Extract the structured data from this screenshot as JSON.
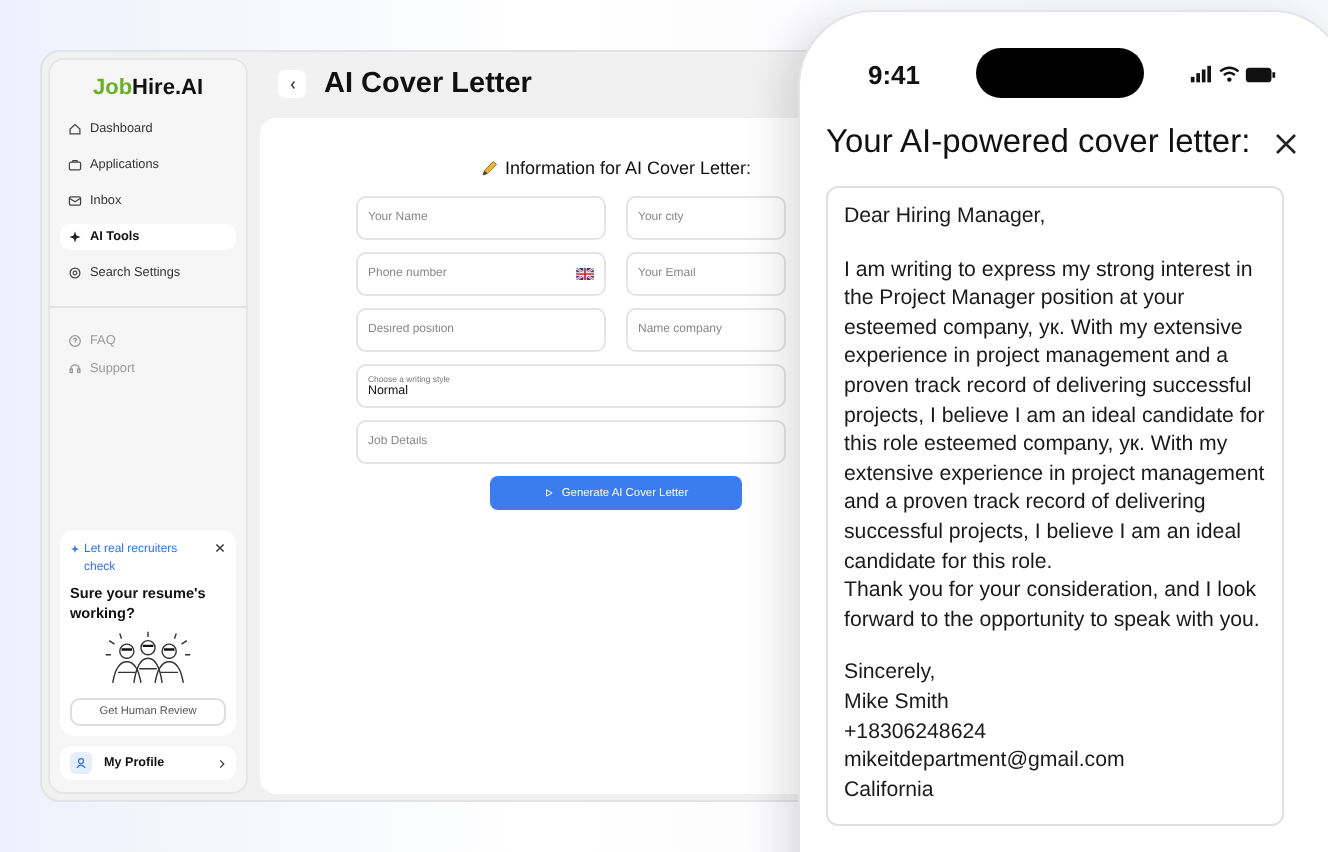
{
  "sidebar": {
    "logo": {
      "accent": "Job",
      "rest": "Hire.AI"
    },
    "nav": [
      {
        "label": "Dashboard",
        "selected": false
      },
      {
        "label": "Applications",
        "selected": false
      },
      {
        "label": "Inbox",
        "selected": false
      },
      {
        "label": "AI Tools",
        "selected": true
      },
      {
        "label": "Search Settings",
        "selected": false
      }
    ],
    "help": [
      {
        "label": "FAQ"
      },
      {
        "label": "Support"
      }
    ],
    "promo": {
      "link": "Let real recruiters check",
      "title": "Sure your resume's working?",
      "button": "Get Human Review"
    },
    "profile": {
      "label": "My Profile"
    }
  },
  "header": {
    "title": "AI Cover Letter"
  },
  "form": {
    "title": "Information for AI Cover Letter:",
    "fields": [
      {
        "placeholder": "Your Name",
        "kind": "text"
      },
      {
        "placeholder": "Your city",
        "kind": "text"
      },
      {
        "placeholder": "Phone number",
        "kind": "phone"
      },
      {
        "placeholder": "Your Email",
        "kind": "text"
      },
      {
        "placeholder": "Desired position",
        "kind": "text"
      },
      {
        "placeholder": "Name company",
        "kind": "text"
      }
    ],
    "style_select": {
      "label": "Choose a writing style",
      "value": "Normal"
    },
    "job_details": {
      "placeholder": "Job Details"
    },
    "button": "Generate AI Cover Letter"
  },
  "phone": {
    "time": "9:41",
    "title": "Your AI-powered cover letter:",
    "letter": {
      "greeting": "Dear Hiring Manager,",
      "body": [
        "I am writing to express my strong interest in the Project Manager position at your esteemed company, ук. With my extensive experience in project management and a proven track record of delivering successful projects, I believe I am an ideal candidate for this role esteemed company, ук. With my extensive experience in project management and a proven track record of delivering successful projects, I believe I am an ideal candidate for this role.",
        "Thank you for your consideration, and I look forward to the opportunity to speak with you."
      ],
      "closing": [
        "Sincerely,",
        "Mike Smith",
        "+18306248624",
        "mikeitdepartment@gmail.com",
        "California"
      ]
    }
  }
}
